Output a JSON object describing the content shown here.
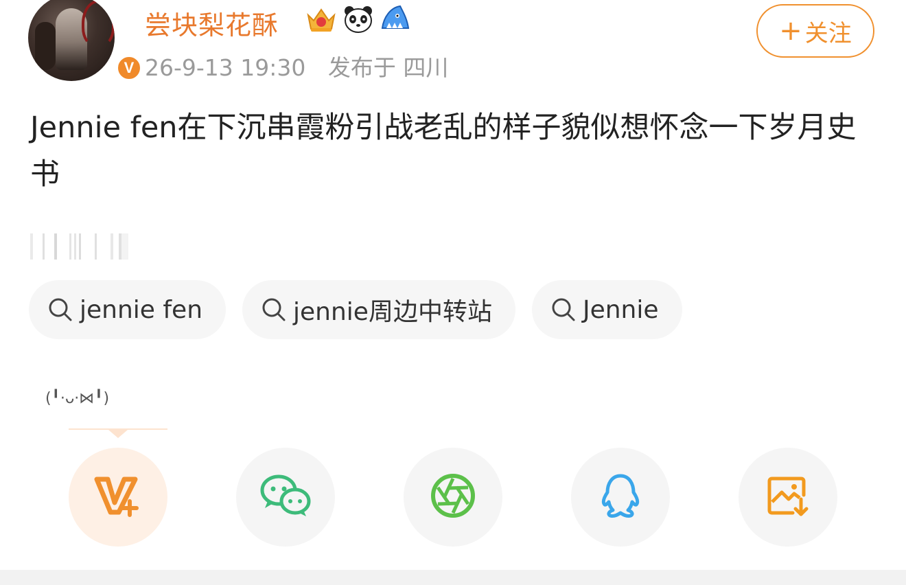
{
  "header": {
    "username": "尝块梨花酥",
    "timestamp": "26-9-13 19:30",
    "location": "发布于 四川",
    "follow_plus": "+",
    "follow_label": "关注",
    "verified_mark": "V",
    "badges": [
      "crown-badge-icon",
      "panda-badge-icon",
      "shark-badge-icon"
    ]
  },
  "post": {
    "text": "Jennie fen在下沉串霞粉引战老乱的样子貌似想怀念一下岁月史书"
  },
  "tags": [
    {
      "label": "jennie fen"
    },
    {
      "label": "jennie周边中转站"
    },
    {
      "label": "Jennie"
    }
  ],
  "kaomoji": "(╹·ᴗ·⋈╹)",
  "share": [
    {
      "icon": "vplus-icon"
    },
    {
      "icon": "wechat-icon"
    },
    {
      "icon": "moments-icon"
    },
    {
      "icon": "qq-icon"
    },
    {
      "icon": "save-image-icon"
    }
  ],
  "colors": {
    "accent": "#e8792d",
    "follow": "#f0902e",
    "wechat": "#3dbb7a",
    "moments": "#5cc04a",
    "qq": "#3aa6ea",
    "save": "#f29a1e"
  }
}
